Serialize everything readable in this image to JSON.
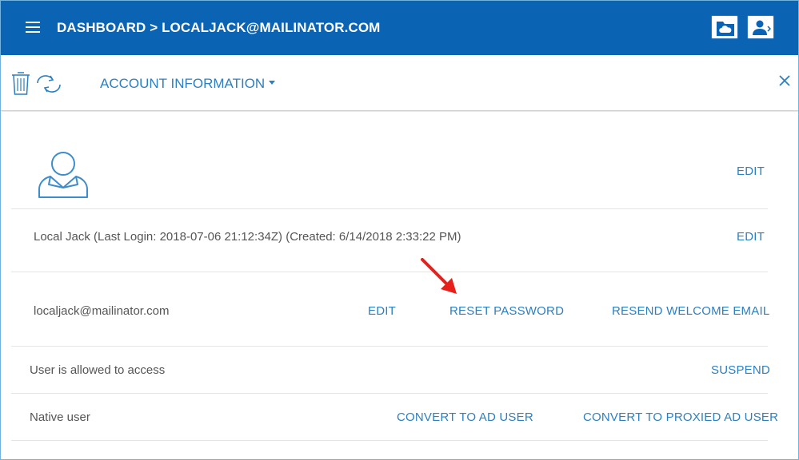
{
  "header": {
    "breadcrumb": "DASHBOARD > LOCALJACK@MAILINATOR.COM",
    "icons": [
      "menu-icon",
      "folder-cloud-icon",
      "user-switch-icon"
    ]
  },
  "toolbar": {
    "section_label": "ACCOUNT INFORMATION",
    "icons": [
      "trash-icon",
      "refresh-icon",
      "close-icon"
    ]
  },
  "account": {
    "avatar_edit": "EDIT",
    "name_line": "Local Jack  (Last Login: 2018-07-06 21:12:34Z) (Created: 6/14/2018 2:33:22 PM)",
    "name_edit": "EDIT",
    "email": "localjack@mailinator.com",
    "email_edit": "EDIT",
    "reset_password": "RESET PASSWORD",
    "resend_welcome": "RESEND WELCOME EMAIL",
    "access_status": "User is allowed to access",
    "suspend": "SUSPEND",
    "user_type": "Native user",
    "convert_ad": "CONVERT TO AD USER",
    "convert_proxied": "CONVERT TO PROXIED AD USER"
  },
  "colors": {
    "header_bg": "#0b63b4",
    "link": "#2c7fc1",
    "annotation_arrow": "#e8201b"
  }
}
